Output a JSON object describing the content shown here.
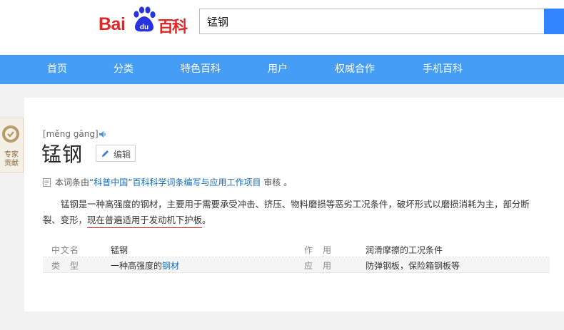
{
  "header": {
    "logo_text_left": "Bai",
    "logo_paw_text": "du",
    "logo_text_right": "百科",
    "search_value": "锰钢"
  },
  "nav": [
    "首页",
    "分类",
    "特色百科",
    "用户",
    "权威合作",
    "手机百科"
  ],
  "badge": {
    "line1": "专家",
    "line2": "贡献"
  },
  "entry": {
    "pinyin": "[měng gāng]",
    "title": "锰钢",
    "edit_label": "编辑"
  },
  "review": {
    "prefix": "本词条由",
    "org": "“科普中国”百科科学词条编写与应用工作项目",
    "suffix": " 审核 。"
  },
  "summary": {
    "main": "锰钢是一种高强度的钢材，主要用于需要承受冲击、挤压、物料磨损等恶劣工况条件，破坏形式以磨损消耗为主，部分断裂、变形，",
    "highlight": "现在普遍适用于发动机下护板",
    "end": "。"
  },
  "basic_info": [
    {
      "k1": "中文名",
      "v1": "锰钢",
      "v1_link": "",
      "k2": "作　用",
      "v2": "润滑摩擦的工况条件"
    },
    {
      "k1": "类　型",
      "v1": "一种高强度的",
      "v1_link": "钢材",
      "k2": "应　用",
      "v2": "防弹钢板，保险箱钢板等"
    }
  ],
  "colors": {
    "brand_red": "#de2726",
    "brand_blue": "#2932e1",
    "nav_blue": "#459df5",
    "link_blue": "#136ec2"
  }
}
